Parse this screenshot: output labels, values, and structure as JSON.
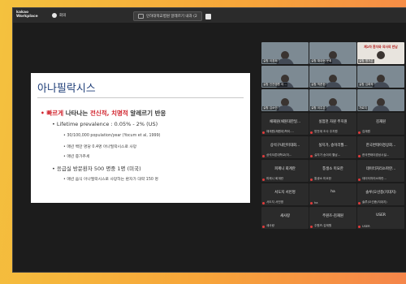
{
  "topbar": {
    "logo_line1": "kakao",
    "logo_line2": "Workplace",
    "user_name": "회의",
    "meeting_title": "인하대학교병원 알레르기 내과 (2"
  },
  "slide": {
    "title": "아나필락시스",
    "bullet1_prefix": "• ",
    "bullet1_red1": "빠르게",
    "bullet1_mid": " 나타나는 ",
    "bullet1_red2": "전신적, 치명적",
    "bullet1_end": " 알레르기 반응",
    "lifetime": "•  Lifetime prevalence : 0.05% - 2%  (US)",
    "sub1": "•  30/100,000 population/year (Yocum et al, 1999)",
    "sub2": "•  매년 백만 명당 0.4명 아나필락시스로 사망",
    "sub3": "•  매년 증가추세",
    "er": "•  응급실 방문환자 500 명중 1명  (미국)",
    "sub4": "•  매년 음식 아나필락시스로 사망하는 환자가 대략 150 명"
  },
  "participants": [
    {
      "type": "camera",
      "name": "실험 이경희"
    },
    {
      "type": "camera",
      "name": "실험 채대현 문희"
    },
    {
      "type": "banner",
      "name": "실험 명가은",
      "banner": "제2차 환자와 의사의 만남"
    },
    {
      "type": "camera",
      "name": "실험 인천병원 이..."
    },
    {
      "type": "camera",
      "name": "실험 박준현"
    },
    {
      "type": "camera",
      "name": "실험 김희락"
    },
    {
      "type": "camera",
      "name": "실험 김소민"
    },
    {
      "type": "camera",
      "name": "실험 이주은"
    },
    {
      "type": "camera",
      "name": "가로지"
    },
    {
      "type": "name",
      "center": "채재원(채원대한일...",
      "sub": "채재원(채원대)학이...."
    },
    {
      "type": "name",
      "center": "실험천 자원 주지원",
      "sub": "방전계 조사 주지원"
    },
    {
      "type": "name",
      "center": "김재원",
      "sub": "김재원"
    },
    {
      "type": "name",
      "center": "상석구내인미대회...",
      "sub": "상석오른대학교(미..."
    },
    {
      "type": "name",
      "center": "실지가, 송이리월...",
      "sub": "실지가 송이리 월남..."
    },
    {
      "type": "name",
      "center": "한국변태이경상회...",
      "sub": "한국변태이경상시설..."
    },
    {
      "type": "name",
      "center": "피제니 회계란",
      "sub": "피제니 회계란"
    },
    {
      "type": "name",
      "center": "통생소 미요한",
      "sub": "통생소 미요한"
    },
    {
      "type": "name",
      "center": "데이터처리소파란...",
      "sub": "데이터처리소파란..."
    },
    {
      "type": "name",
      "center": "서도지 서빈명",
      "sub": "서도지 서빈명"
    },
    {
      "type": "name",
      "center": "ha",
      "sub": "ha"
    },
    {
      "type": "name",
      "center": "솔루(오선종(지대지)",
      "sub": "솔루(오선종(지대지)"
    },
    {
      "type": "name",
      "center": "새사랑",
      "sub": "새사랑"
    },
    {
      "type": "name",
      "center": "주원즈-김재원",
      "sub": "주원즈-김재원"
    },
    {
      "type": "name",
      "center": "USER",
      "sub": "USER"
    }
  ],
  "colors": {
    "background_left": "#f4c23e",
    "background_right": "#f5854a",
    "slide_title": "#1f3e78",
    "emphasis_red": "#d0202a"
  }
}
